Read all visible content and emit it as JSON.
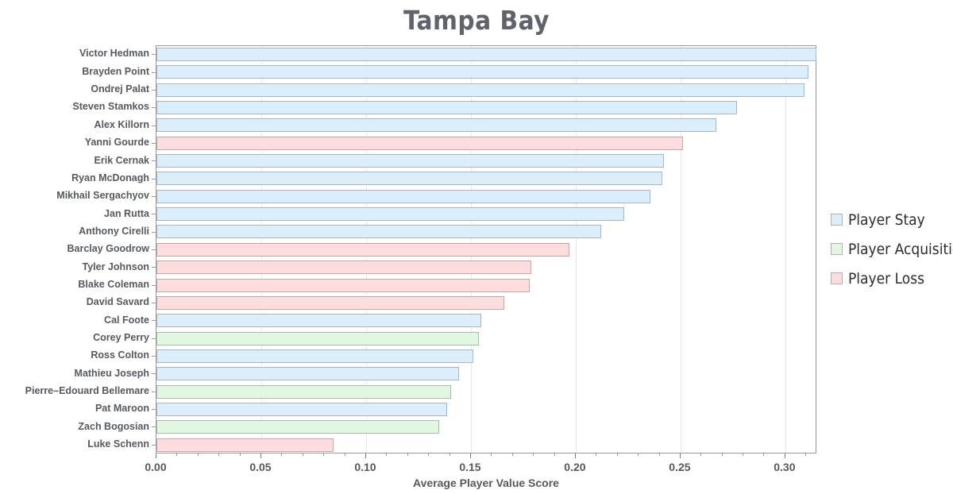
{
  "chart_data": {
    "type": "bar",
    "orientation": "horizontal",
    "title": "Tampa Bay",
    "xlabel": "Average Player Value Score",
    "ylabel": "",
    "xlim": [
      0.0,
      0.3152
    ],
    "xticks": [
      0.0,
      0.05,
      0.1,
      0.15,
      0.2,
      0.25,
      0.3
    ],
    "xticklabels": [
      "0.00",
      "0.05",
      "0.10",
      "0.15",
      "0.20",
      "0.25",
      "0.30"
    ],
    "grid": true,
    "grid_axis": "x",
    "legend_position": "right",
    "categories": [
      "Victor Hedman",
      "Brayden Point",
      "Ondrej Palat",
      "Steven Stamkos",
      "Alex Killorn",
      "Yanni Gourde",
      "Erik Cernak",
      "Ryan McDonagh",
      "Mikhail Sergachyov",
      "Jan Rutta",
      "Anthony Cirelli",
      "Barclay Goodrow",
      "Tyler Johnson",
      "Blake Coleman",
      "David Savard",
      "Cal Foote",
      "Corey Perry",
      "Ross Colton",
      "Mathieu Joseph",
      "Pierre–Edouard Bellemare",
      "Pat Maroon",
      "Zach Bogosian",
      "Luke Schenn"
    ],
    "values": [
      0.315,
      0.311,
      0.309,
      0.277,
      0.267,
      0.251,
      0.242,
      0.2415,
      0.2355,
      0.223,
      0.212,
      0.197,
      0.179,
      0.178,
      0.166,
      0.155,
      0.154,
      0.151,
      0.1445,
      0.1405,
      0.1385,
      0.135,
      0.0845
    ],
    "group": [
      "stay",
      "stay",
      "stay",
      "stay",
      "stay",
      "loss",
      "stay",
      "stay",
      "stay",
      "stay",
      "stay",
      "loss",
      "loss",
      "loss",
      "loss",
      "stay",
      "acquisition",
      "stay",
      "stay",
      "acquisition",
      "stay",
      "acquisition",
      "loss"
    ],
    "series": [
      {
        "name": "Player Stay",
        "key": "stay",
        "color": "#ddeefb",
        "edge": "#a8b5c4"
      },
      {
        "name": "Player Acquisition",
        "key": "acquisition",
        "color": "#e2f7e2",
        "edge": "#a8bda8"
      },
      {
        "name": "Player Loss",
        "key": "loss",
        "color": "#fcdcdc",
        "edge": "#c2a8a8"
      }
    ]
  },
  "legend": {
    "items": [
      {
        "label": "Player Stay",
        "key": "stay"
      },
      {
        "label": "Player Acquisition",
        "key": "acquisition"
      },
      {
        "label": "Player Loss",
        "key": "loss"
      }
    ]
  }
}
